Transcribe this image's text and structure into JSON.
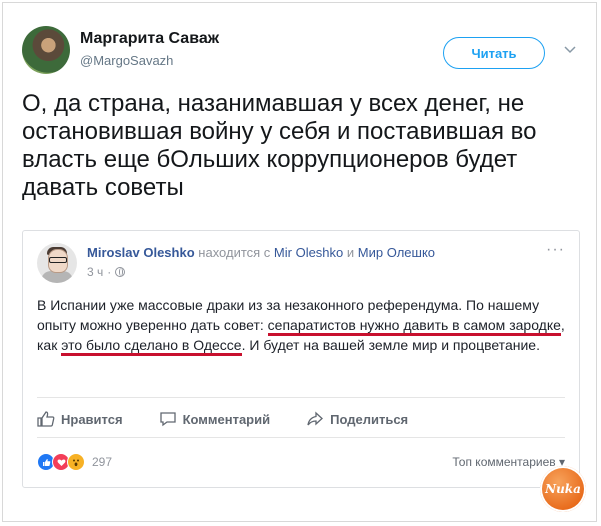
{
  "tweet": {
    "author_name": "Маргарита Саваж",
    "author_handle": "@MargoSavazh",
    "follow_label": "Читать",
    "text": "О, да страна, назанимавшая у всех денег, не остановившая войну у себя и поставившая во власть еще бОльших коррупционеров будет давать советы"
  },
  "fb_post": {
    "author": "Miroslav Oleshko",
    "with_text": "находится с",
    "with_person_1": "Mir Oleshko",
    "and_text": "и",
    "with_person_2": "Мир Олешко",
    "time": "3 ч",
    "dot": "·",
    "text_part_1": "В Испании уже массовые драки из за незаконного референдума. По нашему опыту можно уверенно дать совет: ",
    "text_underlined_1": "сепаратистов нужно давить в самом зародке",
    "text_part_2": ", как ",
    "text_underlined_2": "это было сделано в Одессе",
    "text_part_3": ". И будет на вашей земле мир и процветание.",
    "actions": {
      "like": "Нравится",
      "comment": "Комментарий",
      "share": "Поделиться"
    },
    "reactions_count": "297",
    "sort_label": "Топ комментариев",
    "more_label": "···"
  },
  "watermark_text": "Nuka",
  "colors": {
    "twitter_blue": "#1da1f2",
    "fb_link": "#365899",
    "underline_red": "#c8102e"
  }
}
